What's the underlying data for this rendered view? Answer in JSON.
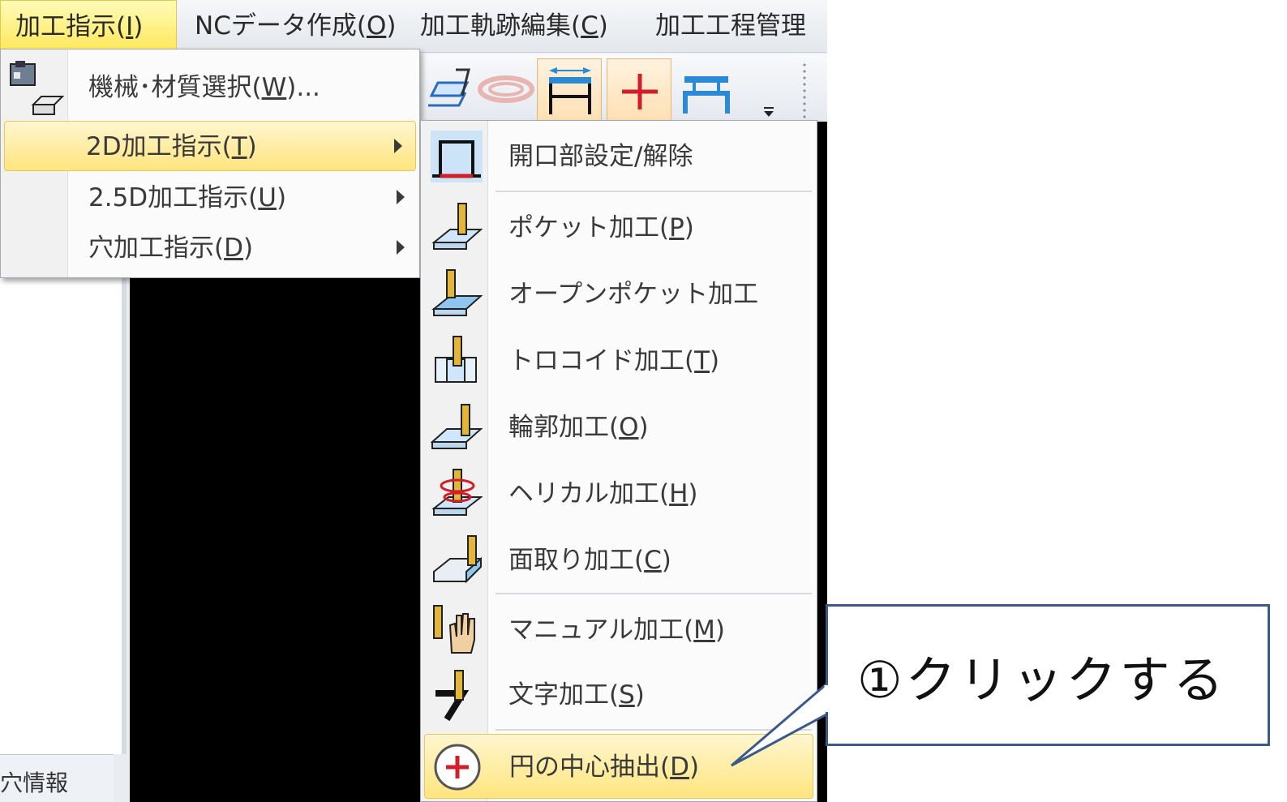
{
  "menubar": {
    "items": [
      {
        "label": "加工指示(",
        "key": "I",
        "end": ")"
      },
      {
        "label": "NCデータ作成(",
        "key": "O",
        "end": ")"
      },
      {
        "label": "加工軌跡編集(",
        "key": "C",
        "end": ")"
      },
      {
        "label": "加工工程管理",
        "key": "",
        "end": ""
      }
    ]
  },
  "menu_main": {
    "items": [
      {
        "label": "機械･材質選択(",
        "key": "W",
        "end": ")..."
      },
      {
        "label": "2D加工指示(",
        "key": "T",
        "end": ")"
      },
      {
        "label": "2.5D加工指示(",
        "key": "U",
        "end": ")"
      },
      {
        "label": "穴加工指示(",
        "key": "D",
        "end": ")"
      }
    ]
  },
  "menu_2d": {
    "items": [
      {
        "label": "開口部設定/解除",
        "key": "",
        "end": ""
      },
      {
        "label": "ポケット加工(",
        "key": "P",
        "end": ")"
      },
      {
        "label": "オープンポケット加工",
        "key": "",
        "end": ""
      },
      {
        "label": "トロコイド加工(",
        "key": "T",
        "end": ")"
      },
      {
        "label": "輪郭加工(",
        "key": "O",
        "end": ")"
      },
      {
        "label": "ヘリカル加工(",
        "key": "H",
        "end": ")"
      },
      {
        "label": "面取り加工(",
        "key": "C",
        "end": ")"
      },
      {
        "label": "マニュアル加工(",
        "key": "M",
        "end": ")"
      },
      {
        "label": "文字加工(",
        "key": "S",
        "end": ")"
      },
      {
        "label": "円の中心抽出(",
        "key": "D",
        "end": ")"
      }
    ]
  },
  "left_panel": {
    "tab_label": "穴情報"
  },
  "callout": {
    "text": "①クリックする"
  },
  "colors": {
    "highlight": "#ffe57e",
    "callout_border": "#3b5a8a",
    "accent_red": "#d11f2a"
  }
}
